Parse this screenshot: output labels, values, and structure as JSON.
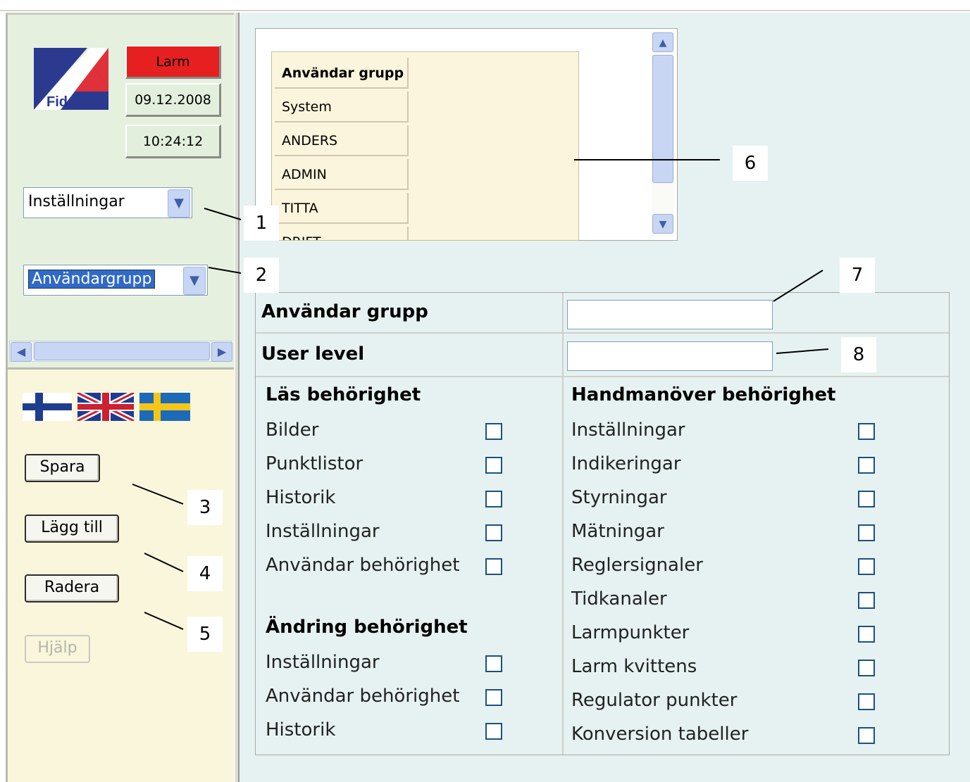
{
  "system": {
    "alarm_label": "Larm",
    "date": "09.12.2008",
    "time": "10:24:12",
    "logo_text": "Fidelix"
  },
  "nav": {
    "menu_select_value": "Inställningar",
    "page_select_value": "Användargrupp"
  },
  "languages": [
    "finnish-flag",
    "uk-flag",
    "swedish-flag"
  ],
  "actions": {
    "save": "Spara",
    "add": "Lägg till",
    "delete": "Radera",
    "help": "Hjälp"
  },
  "group_list": {
    "header": "Användar grupp",
    "items": [
      "System",
      "ANDERS",
      "ADMIN",
      "TITTA",
      "DRIFT"
    ]
  },
  "form": {
    "group_label": "Användar grupp",
    "group_value": "",
    "level_label": "User level",
    "level_value": "",
    "read_title": "Läs behörighet",
    "read_items": [
      "Bilder",
      "Punktlistor",
      "Historik",
      "Inställningar",
      "Användar behörighet"
    ],
    "change_title": "Ändring behörighet",
    "change_items": [
      "Inställningar",
      "Användar behörighet",
      "Historik"
    ],
    "manual_title": "Handmanöver behörighet",
    "manual_items": [
      "Inställningar",
      "Indikeringar",
      "Styrningar",
      "Mätningar",
      "Reglersignaler",
      "Tidkanaler",
      "Larmpunkter",
      "Larm kvittens",
      "Regulator punkter",
      "Konversion tabeller"
    ]
  },
  "callouts": [
    "1",
    "2",
    "3",
    "4",
    "5",
    "6",
    "7",
    "8"
  ],
  "colors": {
    "alarm": "#e62020",
    "left_top_bg": "#e5f0df",
    "left_bottom_bg": "#f9f6dc",
    "right_bg": "#e6f2f1",
    "list_bg": "#faf5dc"
  }
}
